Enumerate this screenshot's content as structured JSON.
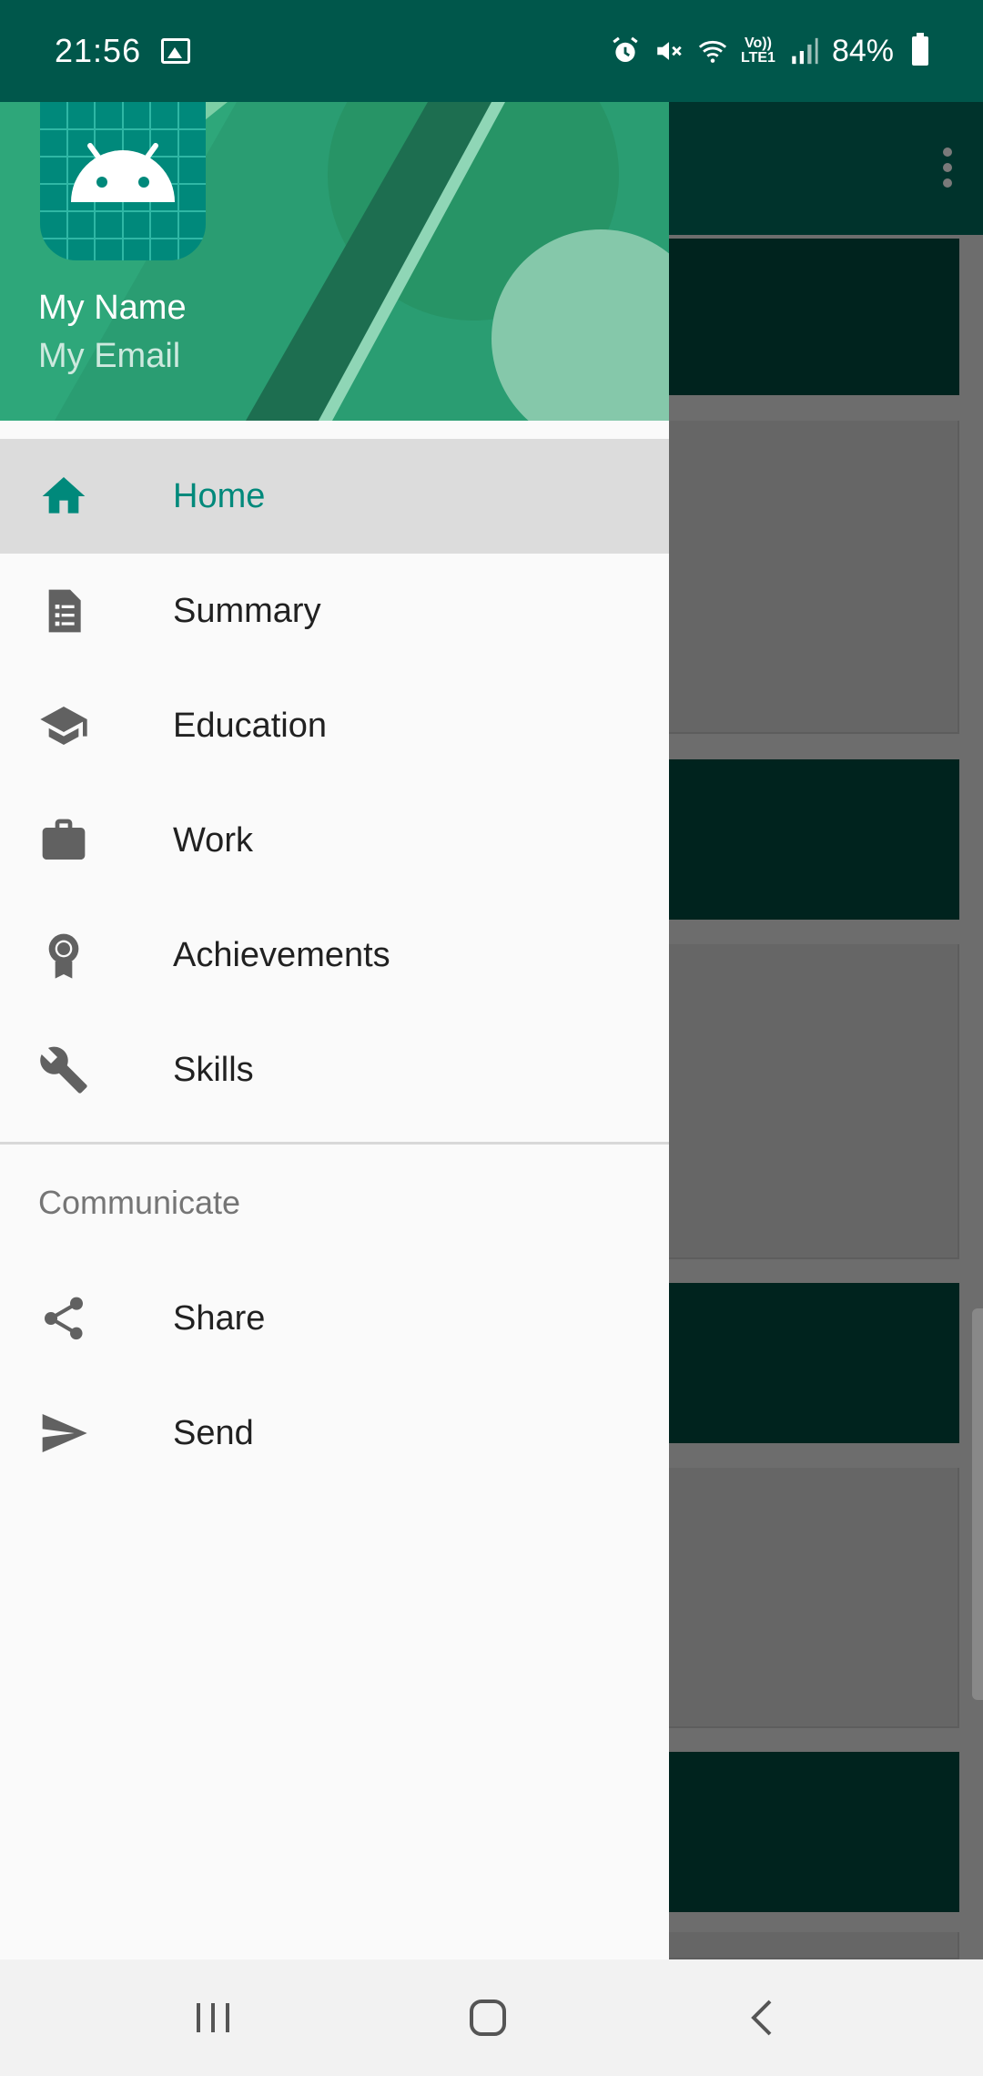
{
  "status_bar": {
    "time": "21:56",
    "lte_top": "Vo))",
    "lte_bottom": "LTE1",
    "battery": "84%"
  },
  "drawer": {
    "header": {
      "name": "My Name",
      "email": "My Email"
    },
    "items": [
      {
        "label": "Home",
        "icon": "home-icon",
        "active": true
      },
      {
        "label": "Summary",
        "icon": "document-list-icon"
      },
      {
        "label": "Education",
        "icon": "graduation-cap-icon"
      },
      {
        "label": "Work",
        "icon": "briefcase-icon"
      },
      {
        "label": "Achievements",
        "icon": "award-icon"
      },
      {
        "label": "Skills",
        "icon": "wrench-icon"
      }
    ],
    "section_title": "Communicate",
    "section_items": [
      {
        "label": "Share",
        "icon": "share-icon"
      },
      {
        "label": "Send",
        "icon": "send-icon"
      }
    ]
  },
  "colors": {
    "primary_dark": "#00574b",
    "accent": "#00897b",
    "header_green": "#2a9d72"
  }
}
